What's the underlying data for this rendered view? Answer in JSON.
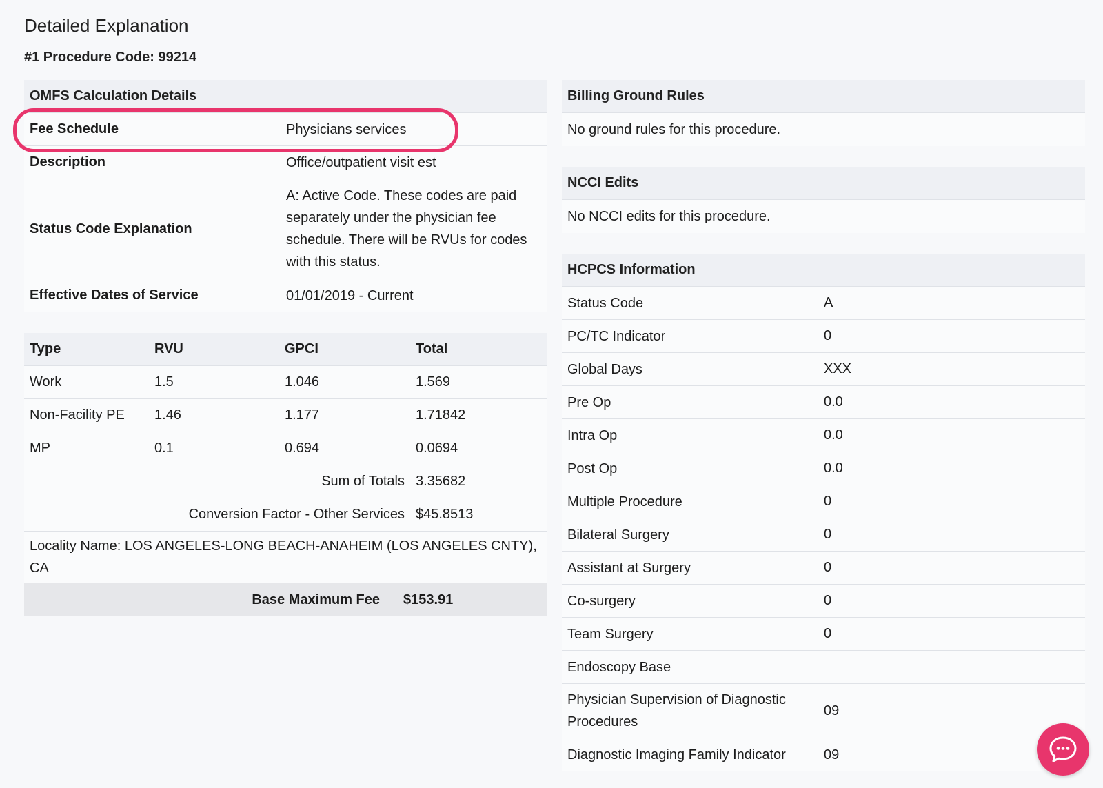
{
  "page": {
    "title": "Detailed Explanation",
    "procedure_code": "#1 Procedure Code: 99214"
  },
  "omfs": {
    "heading": "OMFS Calculation Details",
    "rows": [
      {
        "key": "Fee Schedule",
        "value": "Physicians services"
      },
      {
        "key": "Description",
        "value": "Office/outpatient visit est"
      },
      {
        "key": "Status Code Explanation",
        "value": "A: Active Code. These codes are paid separately under the physician fee schedule. There will be RVUs for codes with this status."
      },
      {
        "key": "Effective Dates of Service",
        "value": "01/01/2019 - Current"
      }
    ]
  },
  "rvu_table": {
    "headers": [
      "Type",
      "RVU",
      "GPCI",
      "Total"
    ],
    "rows": [
      [
        "Work",
        "1.5",
        "1.046",
        "1.569"
      ],
      [
        "Non-Facility PE",
        "1.46",
        "1.177",
        "1.71842"
      ],
      [
        "MP",
        "0.1",
        "0.694",
        "0.0694"
      ]
    ],
    "sum_label": "Sum of Totals",
    "sum_value": "3.35682",
    "cf_label": "Conversion Factor - Other Services",
    "cf_value": "$45.8513",
    "locality": "Locality Name: LOS ANGELES-LONG BEACH-ANAHEIM (LOS ANGELES CNTY), CA",
    "base_label": "Base Maximum Fee",
    "base_value": "$153.91"
  },
  "billing": {
    "heading": "Billing Ground Rules",
    "text": "No ground rules for this procedure."
  },
  "ncci": {
    "heading": "NCCI Edits",
    "text": "No NCCI edits for this procedure."
  },
  "hcpcs": {
    "heading": "HCPCS Information",
    "rows": [
      {
        "key": "Status Code",
        "value": "A"
      },
      {
        "key": "PC/TC Indicator",
        "value": "0"
      },
      {
        "key": "Global Days",
        "value": "XXX"
      },
      {
        "key": "Pre Op",
        "value": "0.0"
      },
      {
        "key": "Intra Op",
        "value": "0.0"
      },
      {
        "key": "Post Op",
        "value": "0.0"
      },
      {
        "key": "Multiple Procedure",
        "value": "0"
      },
      {
        "key": "Bilateral Surgery",
        "value": "0"
      },
      {
        "key": "Assistant at Surgery",
        "value": "0"
      },
      {
        "key": "Co-surgery",
        "value": "0"
      },
      {
        "key": "Team Surgery",
        "value": "0"
      },
      {
        "key": "Endoscopy Base",
        "value": ""
      },
      {
        "key": "Physician Supervision of Diagnostic Procedures",
        "value": "09"
      },
      {
        "key": "Diagnostic Imaging Family Indicator",
        "value": "09"
      }
    ]
  },
  "chat": {
    "icon": "chat-bubble-icon",
    "color": "#e8356c"
  },
  "highlight_color": "#e8356c"
}
